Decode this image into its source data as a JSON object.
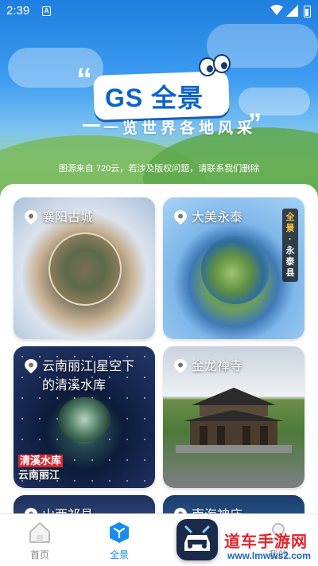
{
  "status_bar": {
    "time": "2:39",
    "notification_badge": "A"
  },
  "hero": {
    "logo_text": "GS 全景",
    "quote_open": "“",
    "quote_close": "”",
    "slogan": "一览世界各地风采",
    "source_note": "图源来自 720云，若涉及版权问题，请联系我们删除"
  },
  "cards": [
    {
      "title": "襄阳古城"
    },
    {
      "title": "大美永泰",
      "vertical_tag": [
        "全",
        "景",
        "·",
        "永",
        "泰",
        "县"
      ]
    },
    {
      "title": "云南丽江|星空下的清溪水库",
      "overlay_red": "清溪水库",
      "overlay_white": "云南丽江"
    },
    {
      "title": "金龙禅寺"
    },
    {
      "title": "山西祁县"
    },
    {
      "title": "南海神庙"
    }
  ],
  "bottom_nav": {
    "items": [
      {
        "label": "首页",
        "icon": "home-icon",
        "active": false
      },
      {
        "label": "全景",
        "icon": "cube-icon",
        "active": true
      },
      {
        "label": "我的",
        "icon": "user-icon",
        "active": false
      }
    ]
  },
  "watermark": {
    "title": "道车手游网",
    "url": "www.lmwws2.com"
  },
  "colors": {
    "accent": "#1a8cf0",
    "logo_blue": "#0b63c8",
    "watermark_red": "#e4232c"
  }
}
